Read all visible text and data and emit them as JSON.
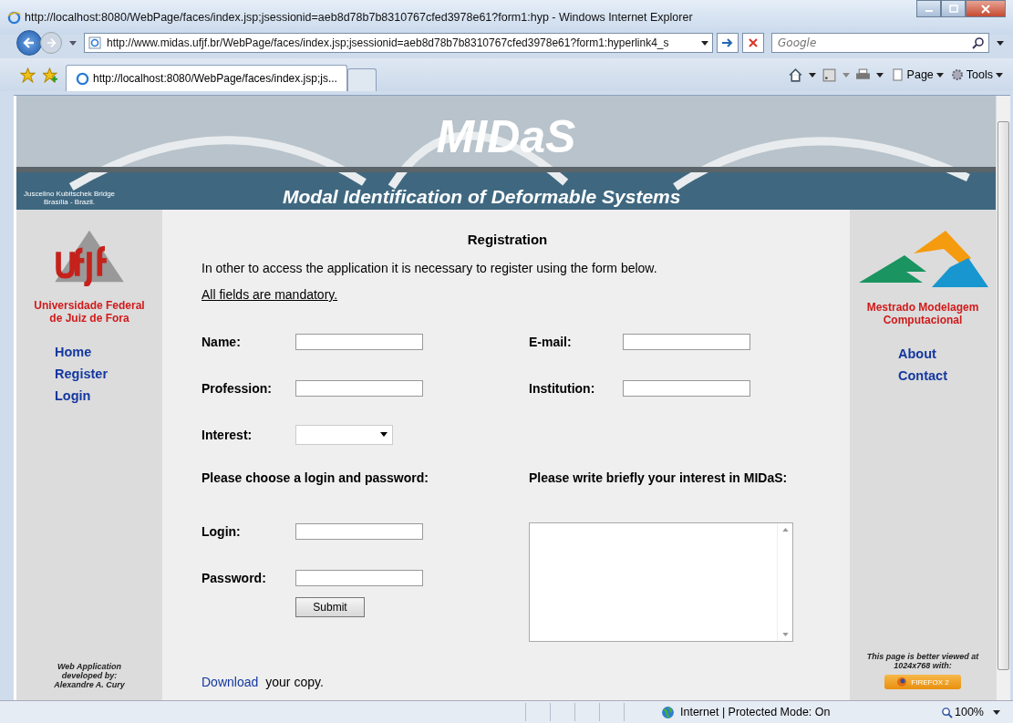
{
  "window": {
    "title": "http://localhost:8080/WebPage/faces/index.jsp;jsessionid=aeb8d78b7b8310767cfed3978e61?form1:hyp - Windows Internet Explorer"
  },
  "address_bar": {
    "url": "http://www.midas.ufjf.br/WebPage/faces/index.jsp;jsessionid=aeb8d78b7b8310767cfed3978e61?form1:hyperlink4_s"
  },
  "search": {
    "placeholder": "Google"
  },
  "tabs": [
    {
      "label": "http://localhost:8080/WebPage/faces/index.jsp;js...",
      "selected": true
    }
  ],
  "command_bar": {
    "page": "Page",
    "tools": "Tools"
  },
  "banner": {
    "title": "MIDaS",
    "subtitle": "Modal Identification of Deformable Systems",
    "caption": [
      "Juscelino Kubitschek Bridge",
      "Brasília - Brazil."
    ]
  },
  "left_sidebar": {
    "institution": [
      "Universidade Federal",
      "de Juiz de Fora"
    ],
    "nav": [
      "Home",
      "Register",
      "Login"
    ],
    "credit": [
      "Web Application",
      "developed by:",
      "Alexandre A. Cury"
    ]
  },
  "right_sidebar": {
    "institution": [
      "Mestrado Modelagem",
      "Computacional"
    ],
    "nav": [
      "About",
      "Contact"
    ],
    "note": [
      "This page is better viewed at",
      "1024x768 with:"
    ],
    "badge": "FIREFOX 2"
  },
  "form": {
    "heading": "Registration",
    "intro": "In other to access the application it is necessary to register using the form below.",
    "mandatory": "All fields are mandatory.",
    "fields": [
      {
        "label": "Name:",
        "kind": "text"
      },
      {
        "label": "E-mail:",
        "kind": "text"
      },
      {
        "label": "Profession:",
        "kind": "text"
      },
      {
        "label": "Institution:",
        "kind": "text"
      },
      {
        "label": "Interest:",
        "kind": "select"
      }
    ],
    "login_heading": "Please choose a login and password:",
    "interest_heading": "Please write briefly your interest in MIDaS:",
    "login_fields": [
      {
        "label": "Login:"
      },
      {
        "label": "Password:"
      }
    ],
    "submit": "Submit"
  },
  "download": {
    "link": "Download",
    "text": "your copy."
  },
  "status_bar": {
    "zone": "Internet | Protected Mode: On",
    "zoom": "100%"
  }
}
